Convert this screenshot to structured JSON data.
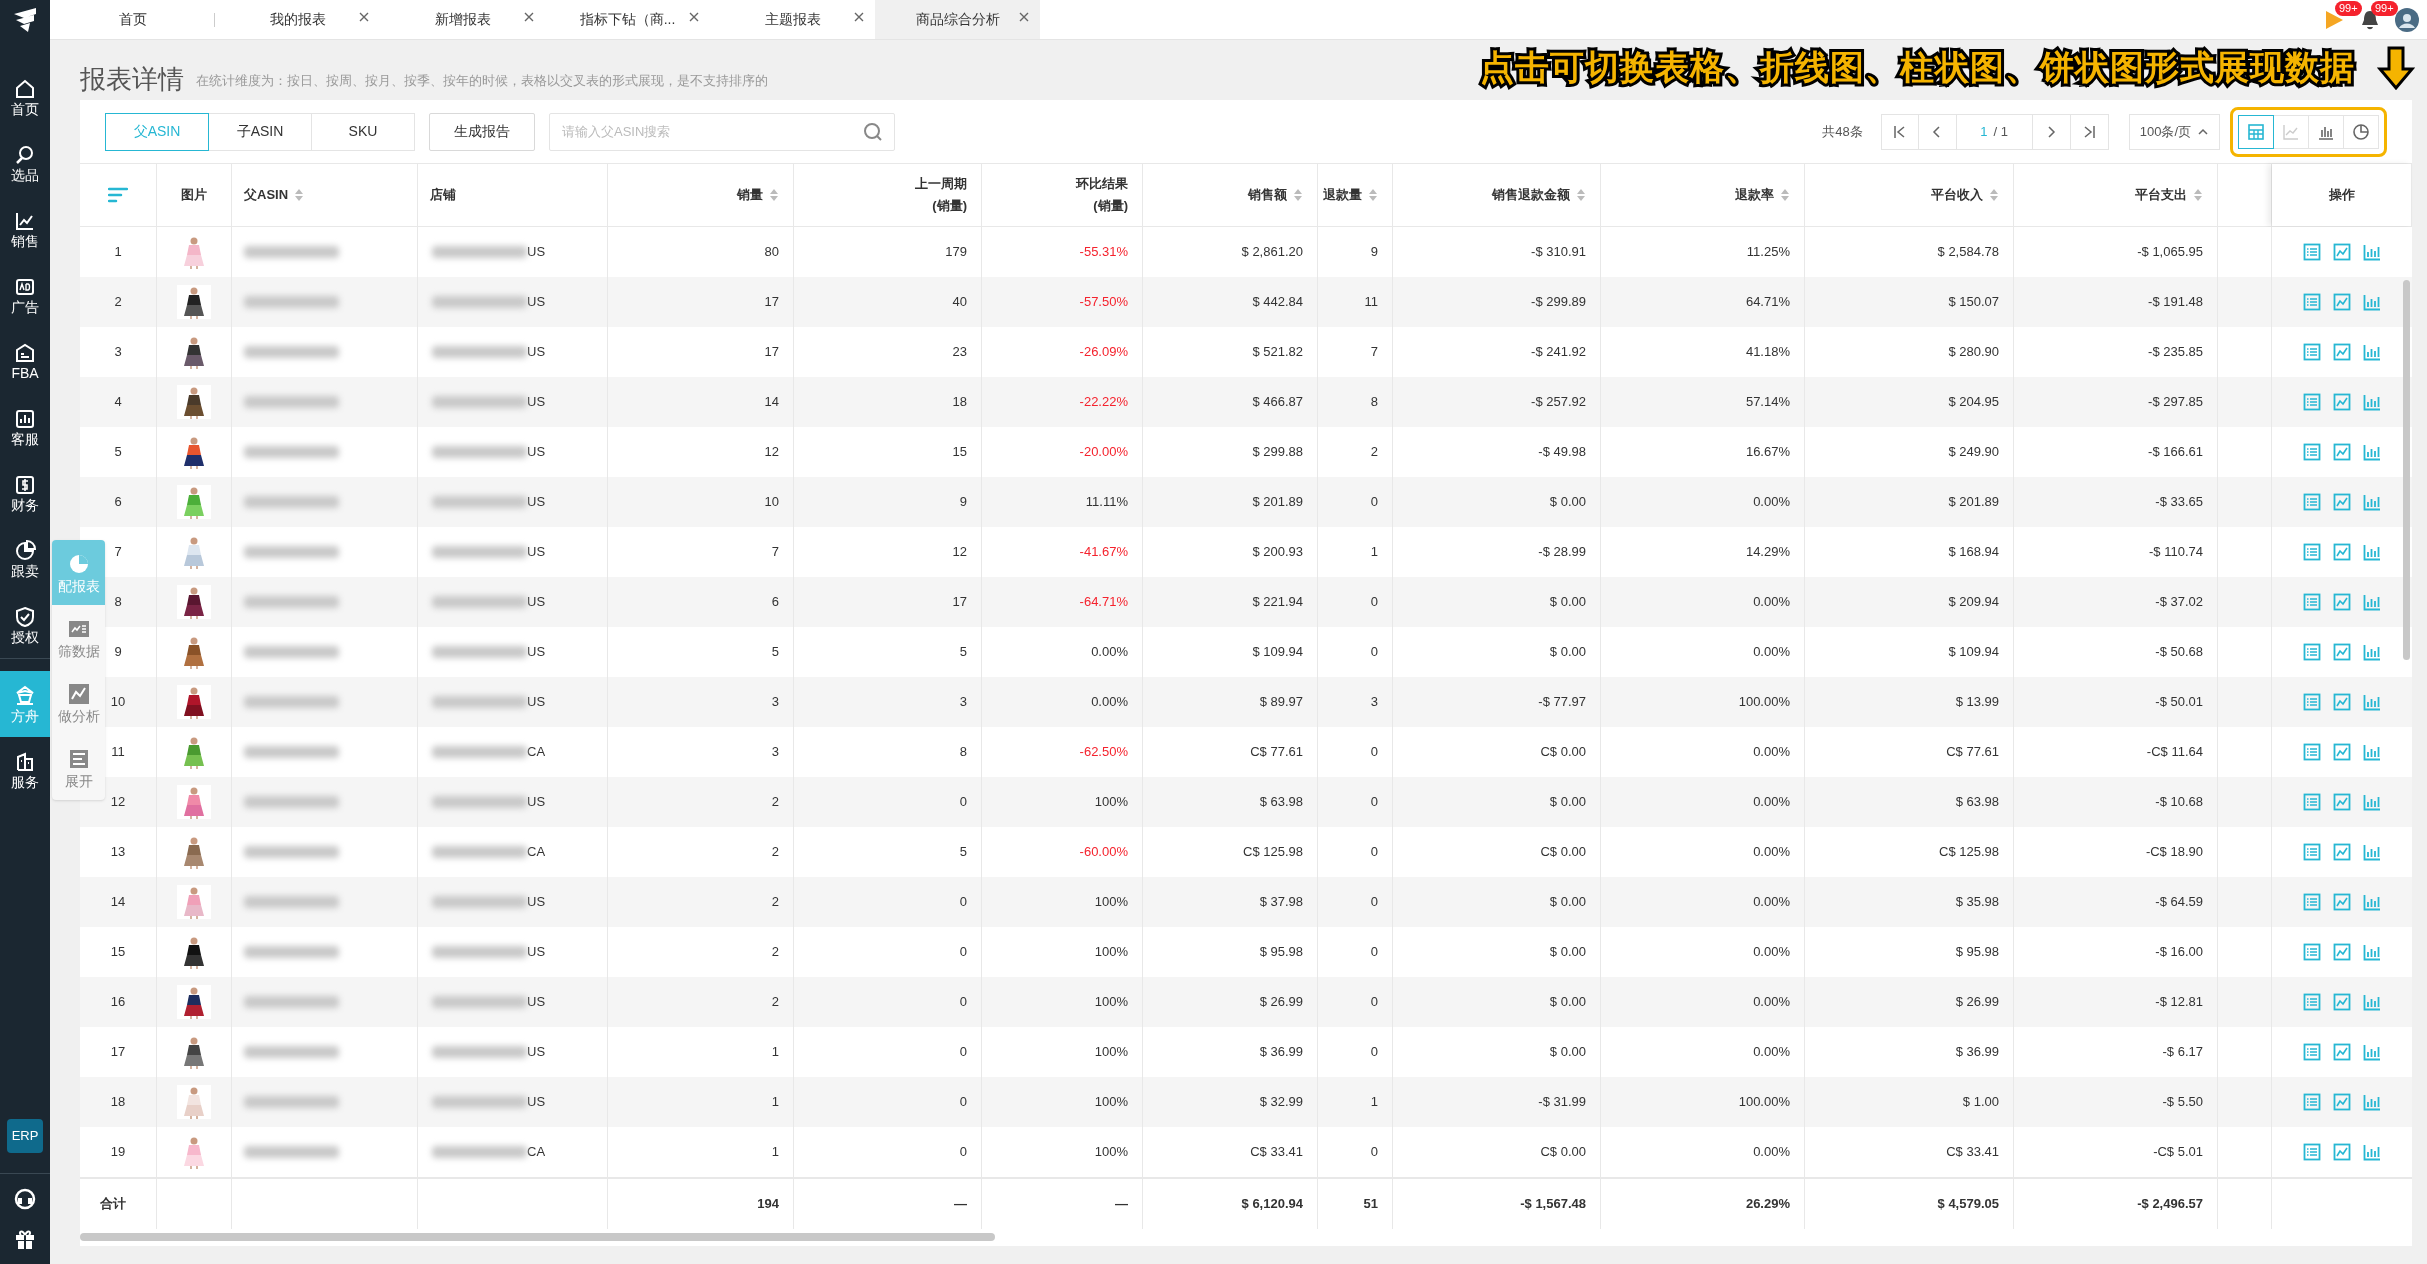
{
  "top_tabs": [
    {
      "label": "首页",
      "closable": false,
      "selected": false
    },
    {
      "label": "我的报表",
      "closable": true,
      "selected": false
    },
    {
      "label": "新增报表",
      "closable": true,
      "selected": false
    },
    {
      "label": "指标下钻（商...",
      "closable": true,
      "selected": false
    },
    {
      "label": "主题报表",
      "closable": true,
      "selected": false
    },
    {
      "label": "商品综合分析",
      "closable": true,
      "selected": true
    }
  ],
  "top_right": {
    "flag_badge": "99+",
    "bell_badge": "99+"
  },
  "sidebar": {
    "items": [
      {
        "label": "首页",
        "selected": false
      },
      {
        "label": "选品",
        "selected": false
      },
      {
        "label": "销售",
        "selected": false
      },
      {
        "label": "广告",
        "selected": false
      },
      {
        "label": "FBA",
        "selected": false
      },
      {
        "label": "客服",
        "selected": false
      },
      {
        "label": "财务",
        "selected": false
      },
      {
        "label": "跟卖",
        "selected": false
      },
      {
        "label": "授权",
        "selected": false
      },
      {
        "label": "方舟",
        "selected": true
      },
      {
        "label": "服务",
        "selected": false
      }
    ],
    "erp": "ERP"
  },
  "float_panel": [
    {
      "label": "配报表",
      "selected": true
    },
    {
      "label": "筛数据",
      "selected": false
    },
    {
      "label": "做分析",
      "selected": false
    },
    {
      "label": "展开",
      "selected": false
    }
  ],
  "page_title": "报表详情",
  "page_hint": "在统计维度为：按日、按周、按月、按季、按年的时候，表格以交叉表的形式展现，是不支持排序的",
  "annotation": "点击可切换表格、折线图、柱状图、饼状图形式展现数据",
  "dimension_tabs": [
    {
      "label": "父ASIN",
      "selected": true
    },
    {
      "label": "子ASIN",
      "selected": false
    },
    {
      "label": "SKU",
      "selected": false
    }
  ],
  "generate_button": "生成报告",
  "search": {
    "placeholder": "请输入父ASIN搜索"
  },
  "pagination": {
    "total": "共48条",
    "page": "1",
    "pages": "/ 1",
    "page_size": "100条/页"
  },
  "view_buttons": [
    {
      "selected": true
    },
    {
      "selected": false
    },
    {
      "selected": false
    },
    {
      "selected": false
    }
  ],
  "table": {
    "columns": [
      {
        "label": "图片",
        "sortable": false
      },
      {
        "label": "父ASIN",
        "sortable": true
      },
      {
        "label": "店铺",
        "sortable": false
      },
      {
        "label": "销量",
        "sortable": true
      },
      {
        "label": "上一周期",
        "sub": "(销量)",
        "sortable": false
      },
      {
        "label": "环比结果",
        "sub": "(销量)",
        "sortable": false
      },
      {
        "label": "销售额",
        "sortable": true
      },
      {
        "label": "退款量",
        "sortable": true
      },
      {
        "label": "销售退款金额",
        "sortable": true
      },
      {
        "label": "退款率",
        "sortable": true
      },
      {
        "label": "平台收入",
        "sortable": true
      },
      {
        "label": "平台支出",
        "sortable": true
      },
      {
        "label": "操作",
        "sortable": false
      }
    ],
    "rows": [
      {
        "index": "1",
        "down": true,
        "cells": [
          "",
          "",
          "US",
          "80",
          "179",
          "-55.31%",
          "$ 2,861.20",
          "9",
          "-$ 310.91",
          "11.25%",
          "$ 2,584.78",
          "-$ 1,065.95"
        ]
      },
      {
        "index": "2",
        "down": true,
        "cells": [
          "",
          "",
          "US",
          "17",
          "40",
          "-57.50%",
          "$ 442.84",
          "11",
          "-$ 299.89",
          "64.71%",
          "$ 150.07",
          "-$ 191.48"
        ]
      },
      {
        "index": "3",
        "down": true,
        "cells": [
          "",
          "",
          "US",
          "17",
          "23",
          "-26.09%",
          "$ 521.82",
          "7",
          "-$ 241.92",
          "41.18%",
          "$ 280.90",
          "-$ 235.85"
        ]
      },
      {
        "index": "4",
        "down": true,
        "cells": [
          "",
          "",
          "US",
          "14",
          "18",
          "-22.22%",
          "$ 466.87",
          "8",
          "-$ 257.92",
          "57.14%",
          "$ 204.95",
          "-$ 297.85"
        ]
      },
      {
        "index": "5",
        "down": true,
        "cells": [
          "",
          "",
          "US",
          "12",
          "15",
          "-20.00%",
          "$ 299.88",
          "2",
          "-$ 49.98",
          "16.67%",
          "$ 249.90",
          "-$ 166.61"
        ]
      },
      {
        "index": "6",
        "down": false,
        "cells": [
          "",
          "",
          "US",
          "10",
          "9",
          "11.11%",
          "$ 201.89",
          "0",
          "$ 0.00",
          "0.00%",
          "$ 201.89",
          "-$ 33.65"
        ]
      },
      {
        "index": "7",
        "down": true,
        "cells": [
          "",
          "",
          "US",
          "7",
          "12",
          "-41.67%",
          "$ 200.93",
          "1",
          "-$ 28.99",
          "14.29%",
          "$ 168.94",
          "-$ 110.74"
        ]
      },
      {
        "index": "8",
        "down": true,
        "cells": [
          "",
          "",
          "US",
          "6",
          "17",
          "-64.71%",
          "$ 221.94",
          "0",
          "$ 0.00",
          "0.00%",
          "$ 209.94",
          "-$ 37.02"
        ]
      },
      {
        "index": "9",
        "down": false,
        "cells": [
          "",
          "",
          "US",
          "5",
          "5",
          "0.00%",
          "$ 109.94",
          "0",
          "$ 0.00",
          "0.00%",
          "$ 109.94",
          "-$ 50.68"
        ]
      },
      {
        "index": "10",
        "down": false,
        "cells": [
          "",
          "",
          "US",
          "3",
          "3",
          "0.00%",
          "$ 89.97",
          "3",
          "-$ 77.97",
          "100.00%",
          "$ 13.99",
          "-$ 50.01"
        ]
      },
      {
        "index": "11",
        "down": true,
        "cells": [
          "",
          "",
          "CA",
          "3",
          "8",
          "-62.50%",
          "C$ 77.61",
          "0",
          "C$ 0.00",
          "0.00%",
          "C$ 77.61",
          "-C$ 11.64"
        ]
      },
      {
        "index": "12",
        "down": false,
        "cells": [
          "",
          "",
          "US",
          "2",
          "0",
          "100%",
          "$ 63.98",
          "0",
          "$ 0.00",
          "0.00%",
          "$ 63.98",
          "-$ 10.68"
        ]
      },
      {
        "index": "13",
        "down": true,
        "cells": [
          "",
          "",
          "CA",
          "2",
          "5",
          "-60.00%",
          "C$ 125.98",
          "0",
          "C$ 0.00",
          "0.00%",
          "C$ 125.98",
          "-C$ 18.90"
        ]
      },
      {
        "index": "14",
        "down": false,
        "cells": [
          "",
          "",
          "US",
          "2",
          "0",
          "100%",
          "$ 37.98",
          "0",
          "$ 0.00",
          "0.00%",
          "$ 35.98",
          "-$ 64.59"
        ]
      },
      {
        "index": "15",
        "down": false,
        "cells": [
          "",
          "",
          "US",
          "2",
          "0",
          "100%",
          "$ 95.98",
          "0",
          "$ 0.00",
          "0.00%",
          "$ 95.98",
          "-$ 16.00"
        ]
      },
      {
        "index": "16",
        "down": false,
        "cells": [
          "",
          "",
          "US",
          "2",
          "0",
          "100%",
          "$ 26.99",
          "0",
          "$ 0.00",
          "0.00%",
          "$ 26.99",
          "-$ 12.81"
        ]
      },
      {
        "index": "17",
        "down": false,
        "cells": [
          "",
          "",
          "US",
          "1",
          "0",
          "100%",
          "$ 36.99",
          "0",
          "$ 0.00",
          "0.00%",
          "$ 36.99",
          "-$ 6.17"
        ]
      },
      {
        "index": "18",
        "down": false,
        "cells": [
          "",
          "",
          "US",
          "1",
          "0",
          "100%",
          "$ 32.99",
          "1",
          "-$ 31.99",
          "100.00%",
          "$ 1.00",
          "-$ 5.50"
        ]
      },
      {
        "index": "19",
        "down": false,
        "cells": [
          "",
          "",
          "CA",
          "1",
          "0",
          "100%",
          "C$ 33.41",
          "0",
          "C$ 0.00",
          "0.00%",
          "C$ 33.41",
          "-C$ 5.01"
        ]
      }
    ],
    "total": {
      "label": "合计",
      "cells": [
        "",
        "",
        "",
        "194",
        "—",
        "—",
        "$ 6,120.94",
        "51",
        "-$ 1,567.48",
        "26.29%",
        "$ 4,579.05",
        "-$ 2,496.57"
      ]
    }
  }
}
